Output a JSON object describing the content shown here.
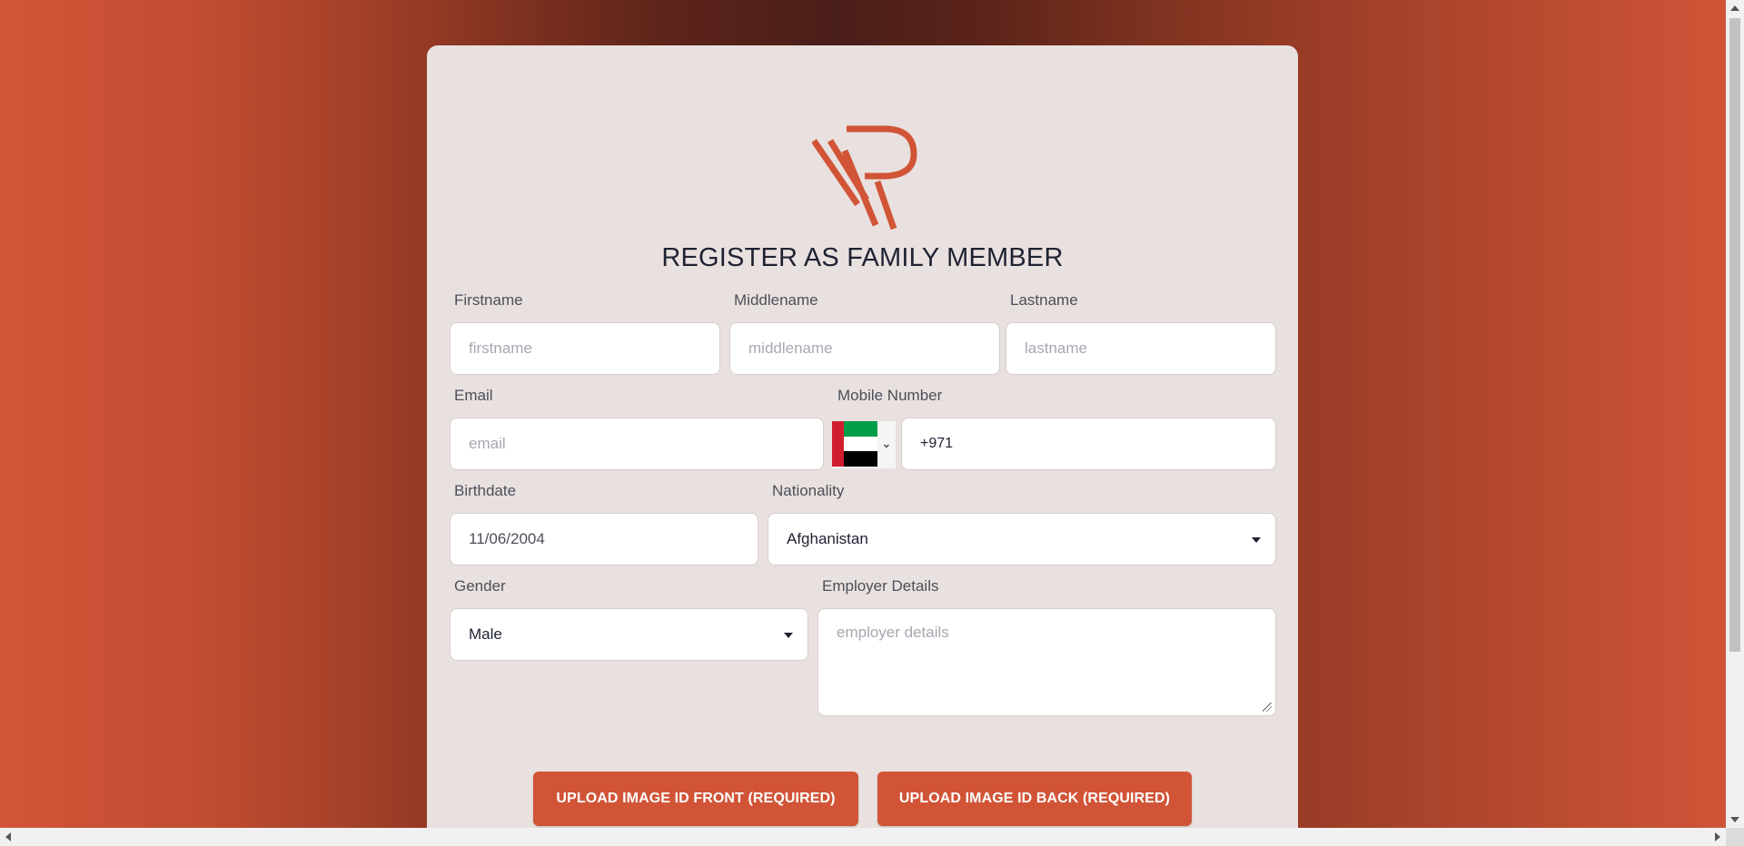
{
  "page": {
    "title": "REGISTER AS FAMILY MEMBER",
    "logo_icon": "wr-monogram-logo",
    "accent_color": "#d15437"
  },
  "form": {
    "firstname": {
      "label": "Firstname",
      "placeholder": "firstname",
      "value": ""
    },
    "middlename": {
      "label": "Middlename",
      "placeholder": "middlename",
      "value": ""
    },
    "lastname": {
      "label": "Lastname",
      "placeholder": "lastname",
      "value": ""
    },
    "email": {
      "label": "Email",
      "placeholder": "email",
      "value": ""
    },
    "mobile": {
      "label": "Mobile Number",
      "country_flag": "uae-flag-icon",
      "value": "+971"
    },
    "birthdate": {
      "label": "Birthdate",
      "value": "11/06/2004"
    },
    "nationality": {
      "label": "Nationality",
      "value": "Afghanistan"
    },
    "gender": {
      "label": "Gender",
      "value": "Male"
    },
    "employer": {
      "label": "Employer Details",
      "placeholder": "employer details",
      "value": ""
    }
  },
  "buttons": {
    "upload_front": "UPLOAD IMAGE ID FRONT (REQUIRED)",
    "upload_back": "UPLOAD IMAGE ID BACK (REQUIRED)"
  }
}
